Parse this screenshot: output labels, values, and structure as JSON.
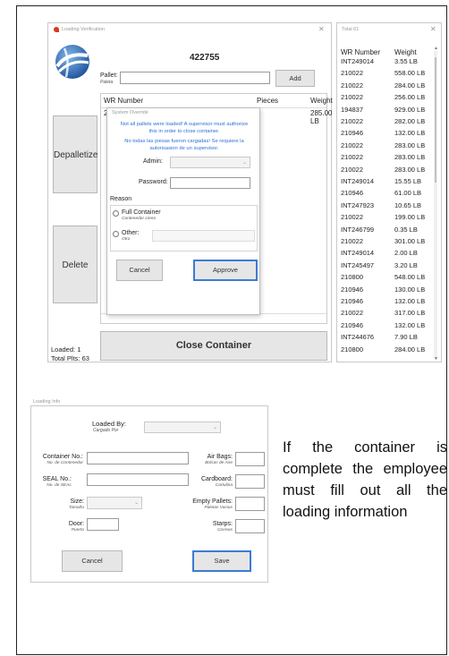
{
  "description_text": "If the container is complete the employee must fill out all the loading information",
  "loading_verification": {
    "title": "Loading Verification",
    "number": "422755",
    "pallet_label": "Pallet:",
    "pallet_sub": "Paleta",
    "add_label": "Add",
    "col_wr": "WR Number",
    "col_pieces": "Pieces",
    "col_weight": "Weight",
    "row_wr": "2",
    "row_weight": "285.00 LB",
    "depalletize_label": "Depalletize",
    "delete_label": "Delete",
    "close_container_label": "Close Container",
    "loaded": "Loaded:  1",
    "total_plts": "Total Plts: 63"
  },
  "system_override": {
    "title": "System Override",
    "msg_en": "Not all pallets were loaded! A supervisor must authorize this in order to close container.",
    "msg_es": "No todas las piesas fueron cargadas! Se requiere la autorisasion de un supervisor.",
    "admin_label": "Admin:",
    "password_label": "Password:",
    "reason_label": "Reason",
    "full_container": "Full Container",
    "full_container_sub": "Contenedor Lleno",
    "other": "Other:",
    "other_sub": "Otro",
    "cancel_label": "Cancel",
    "approve_label": "Approve"
  },
  "totals": {
    "title": "Total 61",
    "col_wr": "WR Number",
    "col_weight": "Weight",
    "rows": [
      {
        "wr": "INT249014",
        "w": "3.55 LB"
      },
      {
        "wr": "210022",
        "w": "558.00 LB"
      },
      {
        "wr": "210022",
        "w": "284.00 LB"
      },
      {
        "wr": "210022",
        "w": "256.00 LB"
      },
      {
        "wr": "194837",
        "w": "929.00 LB"
      },
      {
        "wr": "210022",
        "w": "282.00 LB"
      },
      {
        "wr": "210946",
        "w": "132.00 LB"
      },
      {
        "wr": "210022",
        "w": "283.00 LB"
      },
      {
        "wr": "210022",
        "w": "283.00 LB"
      },
      {
        "wr": "210022",
        "w": "283.00 LB"
      },
      {
        "wr": "INT249014",
        "w": "15.55 LB"
      },
      {
        "wr": "210946",
        "w": "61.00 LB"
      },
      {
        "wr": "INT247923",
        "w": "10.65 LB"
      },
      {
        "wr": "210022",
        "w": "199.00 LB"
      },
      {
        "wr": "INT246799",
        "w": "0.35 LB"
      },
      {
        "wr": "210022",
        "w": "301.00 LB"
      },
      {
        "wr": "INT249014",
        "w": "2.00 LB"
      },
      {
        "wr": "INT245497",
        "w": "3.20 LB"
      },
      {
        "wr": "210800",
        "w": "548.00 LB"
      },
      {
        "wr": "210946",
        "w": "130.00 LB"
      },
      {
        "wr": "210946",
        "w": "132.00 LB"
      },
      {
        "wr": "210022",
        "w": "317.00 LB"
      },
      {
        "wr": "210946",
        "w": "132.00 LB"
      },
      {
        "wr": "INT244676",
        "w": "7.90 LB"
      },
      {
        "wr": "210800",
        "w": "284.00 LB"
      }
    ]
  },
  "loading_info": {
    "title": "Loading Info",
    "loaded_by": "Loaded By:",
    "loaded_by_sub": "Cargado Por",
    "container_no": "Container No.:",
    "container_no_sub": "No. de Contenedor",
    "seal_no": "SEAL No.:",
    "seal_no_sub": "No. de SEAL",
    "size": "Size:",
    "size_sub": "Tamaño",
    "door": "Door:",
    "door_sub": "Puerto",
    "air_bags": "Air Bags:",
    "air_bags_sub": "Bolsas de Aire",
    "cardboard": "Cardboard:",
    "cardboard_sub": "Cartulina",
    "empty_pallets": "Empty Pallets:",
    "empty_pallets_sub": "Paletas Vacias",
    "starps": "Starps:",
    "starps_sub": "Correas",
    "cancel_label": "Cancel",
    "save_label": "Save"
  },
  "colors": {
    "link_blue": "#2a6fd6",
    "button_focus": "#3b7bd4"
  }
}
